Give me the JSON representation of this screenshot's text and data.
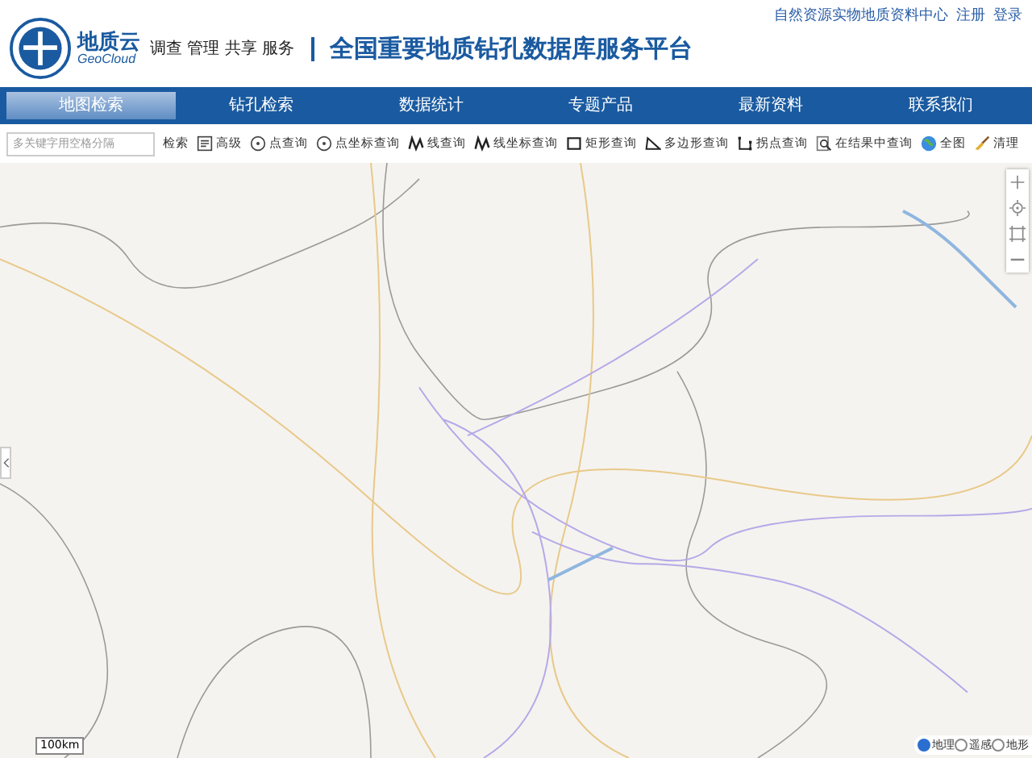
{
  "top_links": [
    "自然资源实物地质资料中心",
    "注册",
    "登录"
  ],
  "header": {
    "brand": "地质云",
    "brand_sub": "GeoCloud",
    "slogan": "调查 管理 共享 服务",
    "title": "全国重要地质钻孔数据库服务平台"
  },
  "nav": [
    {
      "label": "地图检索",
      "selected": true
    },
    {
      "label": "钻孔检索",
      "selected": false
    },
    {
      "label": "数据统计",
      "selected": false
    },
    {
      "label": "专题产品",
      "selected": false
    },
    {
      "label": "最新资料",
      "selected": false
    },
    {
      "label": "联系我们",
      "selected": false
    }
  ],
  "toolbar": {
    "search": {
      "placeholder": "多关键字用空格分隔"
    },
    "search_button": "检索",
    "tools": [
      {
        "kind": "advanced",
        "label": "高级"
      },
      {
        "kind": "point",
        "label": "点查询"
      },
      {
        "kind": "point",
        "label": "点坐标查询"
      },
      {
        "kind": "line",
        "label": "线查询"
      },
      {
        "kind": "line",
        "label": "线坐标查询"
      },
      {
        "kind": "rect",
        "label": "矩形查询"
      },
      {
        "kind": "polygon",
        "label": "多边形查询"
      },
      {
        "kind": "corner",
        "label": "拐点查询"
      },
      {
        "kind": "filter",
        "label": "在结果中查询"
      },
      {
        "kind": "globe",
        "label": "全图"
      },
      {
        "kind": "broom",
        "label": "清理"
      }
    ]
  },
  "map": {
    "scale": "100km",
    "layers": [
      {
        "label": "地理",
        "selected": true
      },
      {
        "label": "遥感",
        "selected": false
      },
      {
        "label": "地形",
        "selected": false
      }
    ]
  }
}
